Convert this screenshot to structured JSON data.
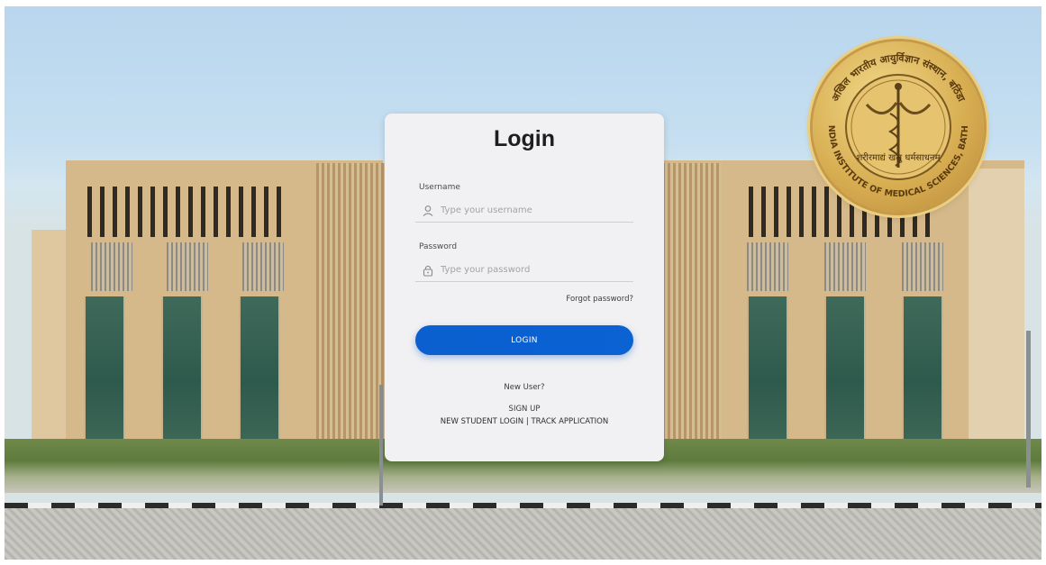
{
  "card": {
    "title": "Login",
    "username": {
      "label": "Username",
      "placeholder": "Type your username",
      "value": ""
    },
    "password": {
      "label": "Password",
      "placeholder": "Type your password",
      "value": ""
    },
    "forgot": "Forgot password?",
    "login_button": "LOGIN",
    "new_user": "New User?",
    "sign_up": "SIGN UP",
    "new_student_login": "NEW STUDENT LOGIN",
    "separator": " | ",
    "track_application": "TRACK APPLICATION"
  },
  "seal": {
    "outer_text_top": "अखिल भारतीय आयुर्विज्ञान संस्थान, बठिंडा",
    "outer_text_bottom": "ALL INDIA INSTITUTE OF MEDICAL SCIENCES, BATHINDA",
    "motto": "शरीरमाद्यं खलु धर्मसाधनम्"
  },
  "colors": {
    "accent": "#0b5fcf",
    "card": "#f1f1f3",
    "seal_gold": "#d8ae52"
  }
}
